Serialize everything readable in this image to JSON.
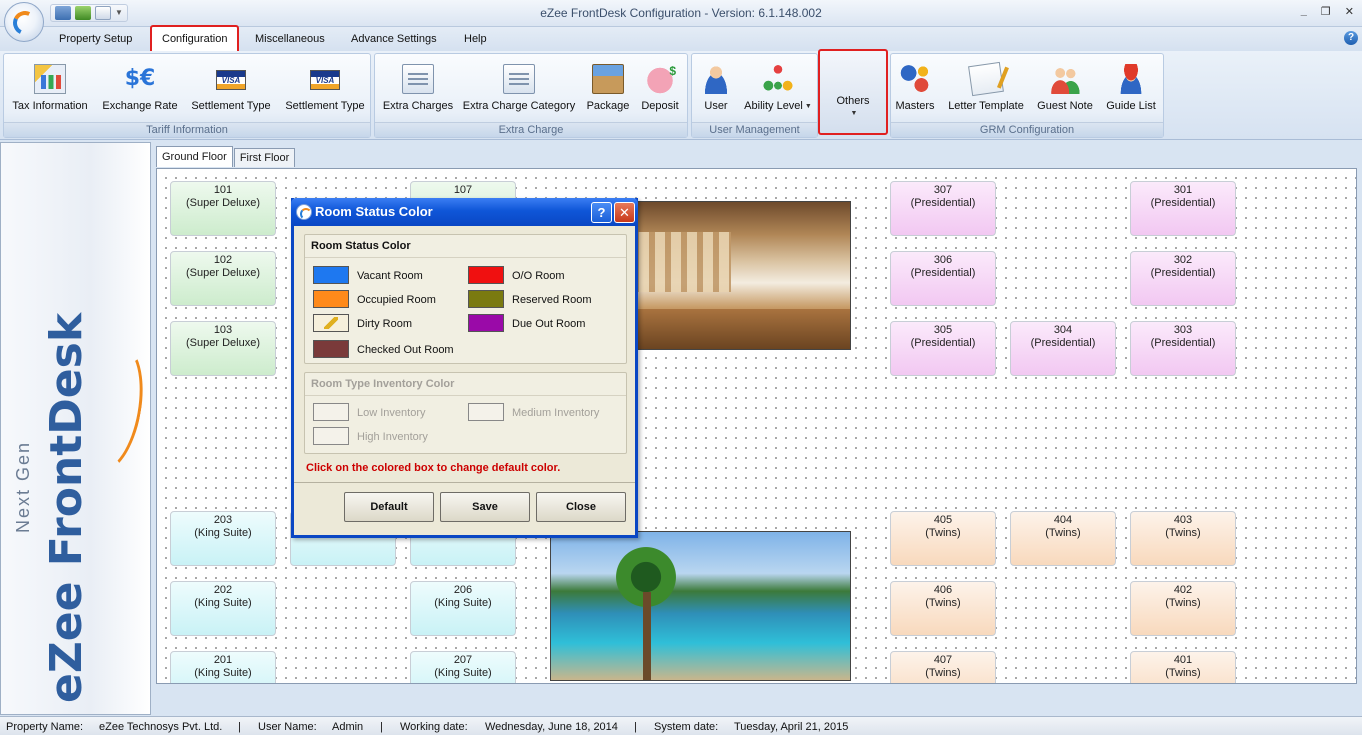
{
  "window": {
    "title": "eZee FrontDesk Configuration - Version: 6.1.148.002",
    "minimize": "_",
    "restore": "❐",
    "close": "✕"
  },
  "menu": {
    "tabs": [
      "Property Setup",
      "Configuration",
      "Miscellaneous",
      "Advance Settings",
      "Help"
    ],
    "active": "Configuration",
    "help_icon": "?"
  },
  "ribbon": {
    "groups": {
      "tariff": {
        "label": "Tariff Information",
        "buttons": [
          "Tax Information",
          "Exchange Rate",
          "Settlement Type",
          "Settlement Type"
        ]
      },
      "extra": {
        "label": "Extra Charge",
        "buttons": [
          "Extra Charges",
          "Extra Charge Category",
          "Package",
          "Deposit"
        ]
      },
      "user": {
        "label": "User Management",
        "buttons": [
          "User",
          "Ability Level"
        ]
      },
      "others": {
        "label": "Others"
      },
      "grm": {
        "label": "GRM Configuration",
        "buttons": [
          "Masters",
          "Letter Template",
          "Guest Note",
          "Guide List"
        ]
      }
    },
    "icons": {
      "exchange": "$€",
      "visa": "VISA"
    }
  },
  "logo": {
    "main": "eZee FrontDesk",
    "sub": "Next Gen"
  },
  "floors": {
    "tabs": [
      "Ground Floor",
      "First Floor"
    ],
    "active": "Ground Floor"
  },
  "rooms": {
    "r101": {
      "no": "101",
      "type": "(Super Deluxe)"
    },
    "r102": {
      "no": "102",
      "type": "(Super Deluxe)"
    },
    "r103": {
      "no": "103",
      "type": "(Super Deluxe)"
    },
    "r107": {
      "no": "107",
      "type": ""
    },
    "r307": {
      "no": "307",
      "type": "(Presidential)"
    },
    "r301": {
      "no": "301",
      "type": "(Presidential)"
    },
    "r306": {
      "no": "306",
      "type": "(Presidential)"
    },
    "r302": {
      "no": "302",
      "type": "(Presidential)"
    },
    "r305": {
      "no": "305",
      "type": "(Presidential)"
    },
    "r304": {
      "no": "304",
      "type": "(Presidential)"
    },
    "r303": {
      "no": "303",
      "type": "(Presidential)"
    },
    "r203": {
      "no": "203",
      "type": "(King Suite)"
    },
    "r202": {
      "no": "202",
      "type": "(King Suite)"
    },
    "r201": {
      "no": "201",
      "type": "(King Suite)"
    },
    "r206": {
      "no": "206",
      "type": "(King Suite)"
    },
    "r207": {
      "no": "207",
      "type": "(King Suite)"
    },
    "r405": {
      "no": "405",
      "type": "(Twins)"
    },
    "r404": {
      "no": "404",
      "type": "(Twins)"
    },
    "r403": {
      "no": "403",
      "type": "(Twins)"
    },
    "r406": {
      "no": "406",
      "type": "(Twins)"
    },
    "r402": {
      "no": "402",
      "type": "(Twins)"
    },
    "r407": {
      "no": "407",
      "type": "(Twins)"
    },
    "r401": {
      "no": "401",
      "type": "(Twins)"
    }
  },
  "dialog": {
    "title": "Room Status Color",
    "help_btn": "?",
    "close_btn": "✕",
    "status_section": "Room Status Color",
    "status_items": [
      {
        "label": "Vacant Room",
        "color": "#1e78f0"
      },
      {
        "label": "O/O Room",
        "color": "#f01010"
      },
      {
        "label": "Occupied Room",
        "color": "#ff8a1a"
      },
      {
        "label": "Reserved Room",
        "color": "#7a7a10"
      },
      {
        "label": "Dirty Room",
        "color": "#f6f0dc"
      },
      {
        "label": "Due Out Room",
        "color": "#9a0aa8"
      },
      {
        "label": "Checked Out Room",
        "color": "#7a3a3a"
      }
    ],
    "inventory_section": "Room Type Inventory Color",
    "inventory_items": [
      {
        "label": "Low Inventory"
      },
      {
        "label": "Medium Inventory"
      },
      {
        "label": "High Inventory"
      }
    ],
    "notice": "Click on the colored box to change default color.",
    "buttons": {
      "default": "Default",
      "save": "Save",
      "close": "Close"
    }
  },
  "status_bar": {
    "property_label": "Property Name:",
    "property_value": "eZee Technosys Pvt. Ltd.",
    "user_label": "User Name:",
    "user_value": "Admin",
    "working_label": "Working date:",
    "working_value": "Wednesday, June 18, 2014",
    "system_label": "System date:",
    "system_value": "Tuesday, April 21, 2015",
    "separator": "|"
  },
  "colors": {
    "highlight_red": "#e02020",
    "dialog_blue": "#0a47c4",
    "notice_red": "#cc0000"
  }
}
